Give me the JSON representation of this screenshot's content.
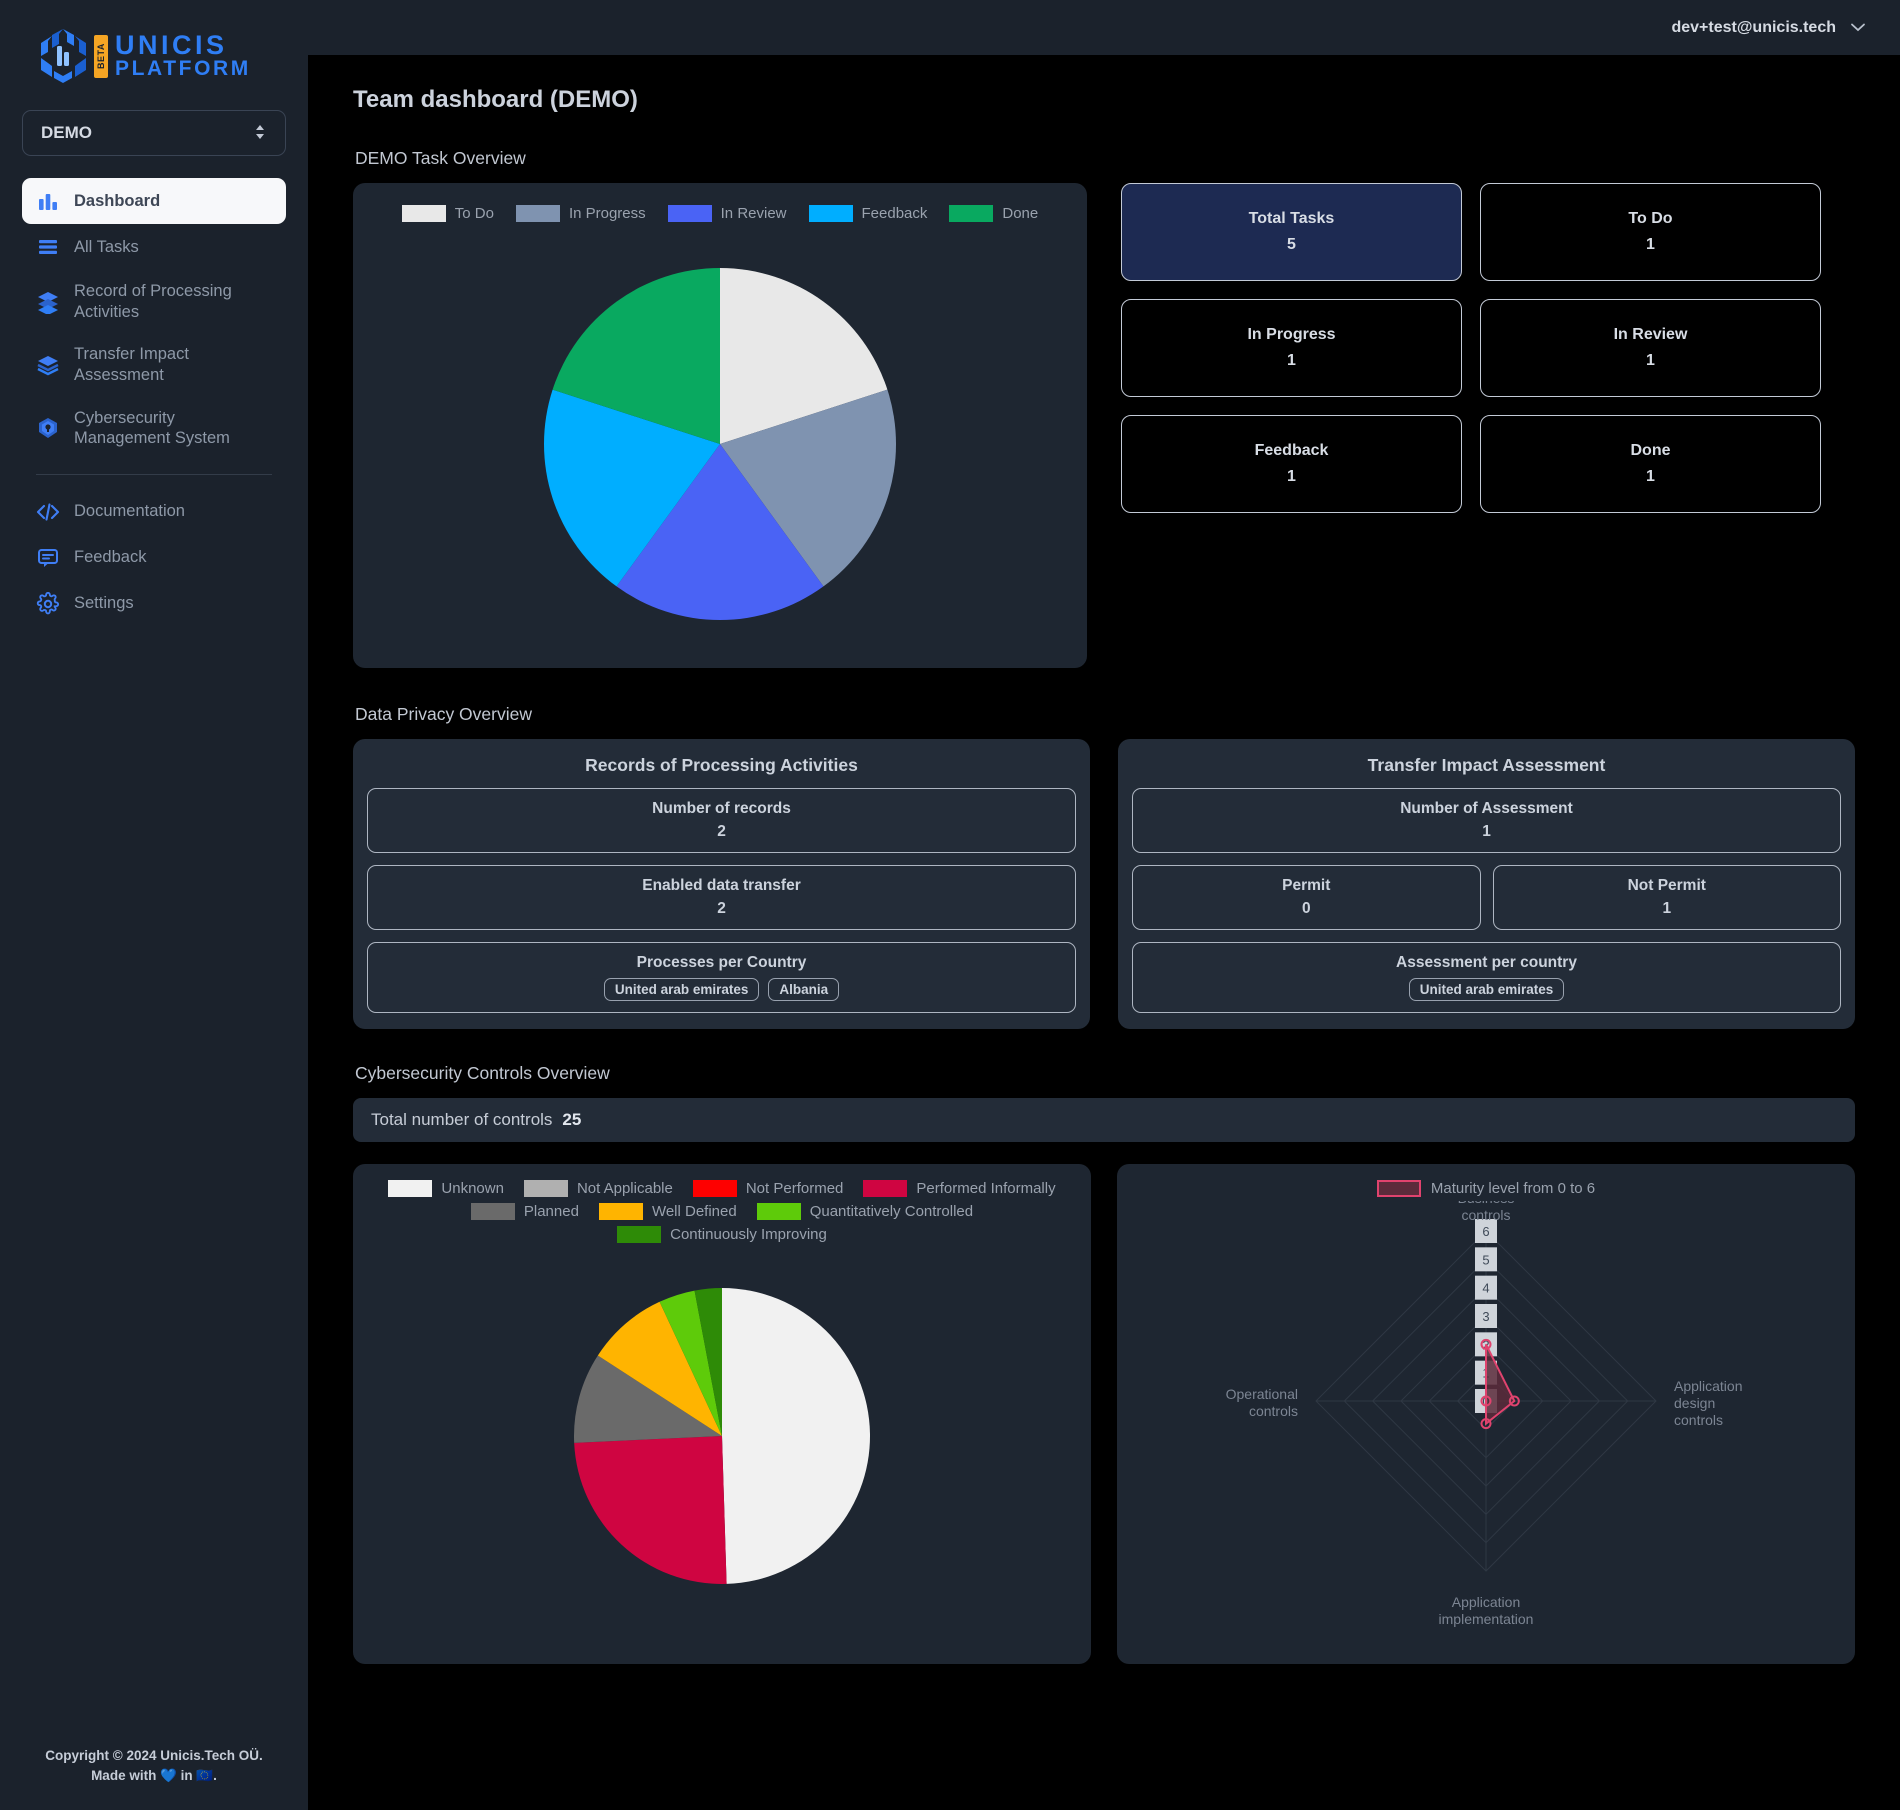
{
  "brand": {
    "name_line1": "UNICIS",
    "name_line2": "PLATFORM",
    "badge": "BETA",
    "logo_icon": "unicis-hex-logo-icon",
    "accent": "#2f7ef5",
    "badge_color": "#f5a524"
  },
  "sidebar": {
    "org_selector": {
      "value": "DEMO",
      "icon": "chevron-updown-icon"
    },
    "items": [
      {
        "label": "Dashboard",
        "icon": "bar-chart-icon",
        "active": true
      },
      {
        "label": "All Tasks",
        "icon": "stack-lines-icon",
        "active": false
      },
      {
        "label": "Record of Processing Activities",
        "icon": "layers-icon",
        "active": false
      },
      {
        "label": "Transfer Impact Assessment",
        "icon": "transfer-layers-icon",
        "active": false
      },
      {
        "label": "Cybersecurity Management System",
        "icon": "shield-hex-icon",
        "active": false
      }
    ],
    "secondary_items": [
      {
        "label": "Documentation",
        "icon": "code-brackets-icon"
      },
      {
        "label": "Feedback",
        "icon": "chat-bubble-icon"
      },
      {
        "label": "Settings",
        "icon": "gear-icon"
      }
    ],
    "footer": {
      "line1": "Copyright © 2024 Unicis.Tech OÜ.",
      "line2": "Made with 💙 in 🇪🇺."
    }
  },
  "topbar": {
    "user_email": "dev+test@unicis.tech",
    "chevron_icon": "chevron-down-icon"
  },
  "page": {
    "title": "Team dashboard (DEMO)",
    "sections": {
      "task_overview": "DEMO Task Overview",
      "data_privacy": "Data Privacy Overview",
      "cybersecurity": "Cybersecurity Controls Overview"
    }
  },
  "task_stats": [
    {
      "title": "Total Tasks",
      "value": "5",
      "accent": true
    },
    {
      "title": "To Do",
      "value": "1",
      "accent": false
    },
    {
      "title": "In Progress",
      "value": "1",
      "accent": false
    },
    {
      "title": "In Review",
      "value": "1",
      "accent": false
    },
    {
      "title": "Feedback",
      "value": "1",
      "accent": false
    },
    {
      "title": "Done",
      "value": "1",
      "accent": false
    }
  ],
  "data_privacy": {
    "ropa": {
      "heading": "Records of Processing Activities",
      "number_of_records": {
        "title": "Number of records",
        "value": "2"
      },
      "enabled_data_transfer": {
        "title": "Enabled data transfer",
        "value": "2"
      },
      "processes_per_country": {
        "title": "Processes per Country",
        "countries": [
          "United arab emirates",
          "Albania"
        ]
      }
    },
    "tia": {
      "heading": "Transfer Impact Assessment",
      "number_of_assessment": {
        "title": "Number of Assessment",
        "value": "1"
      },
      "permit": {
        "title": "Permit",
        "value": "0"
      },
      "not_permit": {
        "title": "Not Permit",
        "value": "1"
      },
      "assessment_per_country": {
        "title": "Assessment per country",
        "countries": [
          "United arab emirates"
        ]
      }
    }
  },
  "cybersecurity": {
    "total_label": "Total number of controls",
    "total_value": "25"
  },
  "chart_data": [
    {
      "type": "pie",
      "title": "DEMO Task Overview",
      "legend_position": "top",
      "categories": [
        "To Do",
        "In Progress",
        "In Review",
        "Feedback",
        "Done"
      ],
      "values": [
        1,
        1,
        1,
        1,
        1
      ],
      "percentages": [
        20,
        20,
        20,
        20,
        20
      ],
      "colors": [
        "#e8e8e8",
        "#7f93b0",
        "#4a63f5",
        "#00aeff",
        "#09a960"
      ]
    },
    {
      "type": "pie",
      "title": "Cybersecurity Controls Overview",
      "legend_position": "top",
      "categories": [
        "Unknown",
        "Not Applicable",
        "Not Performed",
        "Performed Informally",
        "Planned",
        "Well Defined",
        "Quantitatively Controlled",
        "Continuously Improving"
      ],
      "values": [
        12.5,
        0,
        0,
        6.25,
        2.5,
        2.25,
        1,
        0.75
      ],
      "percentages": [
        50,
        0,
        0,
        25,
        10,
        9,
        4,
        3
      ],
      "colors": [
        "#f1f1f1",
        "#b0b0b0",
        "#fe0000",
        "#cf0541",
        "#6a6a6a",
        "#ffb400",
        "#5ecb0a",
        "#2e8b07"
      ]
    },
    {
      "type": "radar",
      "title": "Maturity level from 0 to 6",
      "legend": [
        "Maturity level from 0 to 6"
      ],
      "axes": [
        "Business controls",
        "Application design controls",
        "Application implementation controls",
        "Operational controls"
      ],
      "values": [
        2,
        1,
        0.8,
        0
      ],
      "ticks": [
        "0",
        "1",
        "2",
        "3",
        "4",
        "5",
        "6"
      ],
      "range": [
        0,
        6
      ],
      "color": "#e0436e",
      "fill": "#5c2b3b"
    }
  ],
  "legends": {
    "tasks": [
      {
        "label": "To Do",
        "color": "#e8e8e8"
      },
      {
        "label": "In Progress",
        "color": "#7f93b0"
      },
      {
        "label": "In Review",
        "color": "#4a63f5"
      },
      {
        "label": "Feedback",
        "color": "#00aeff"
      },
      {
        "label": "Done",
        "color": "#09a960"
      }
    ],
    "controls_row1": [
      {
        "label": "Unknown",
        "color": "#f1f1f1"
      },
      {
        "label": "Not Applicable",
        "color": "#b0b0b0"
      },
      {
        "label": "Not Performed",
        "color": "#fe0000"
      },
      {
        "label": "Performed Informally",
        "color": "#cf0541"
      }
    ],
    "controls_row2": [
      {
        "label": "Planned",
        "color": "#6a6a6a"
      },
      {
        "label": "Well Defined",
        "color": "#ffb400"
      },
      {
        "label": "Quantitatively Controlled",
        "color": "#5ecb0a"
      }
    ],
    "controls_row3": [
      {
        "label": "Continuously Improving",
        "color": "#2e8b07"
      }
    ],
    "radar": {
      "label": "Maturity level from 0 to 6",
      "color": "#e0436e"
    }
  },
  "radar_labels": {
    "top": "Business controls",
    "right": "Application design controls",
    "bottom": "Application implementation controls",
    "left": "Operational controls"
  }
}
